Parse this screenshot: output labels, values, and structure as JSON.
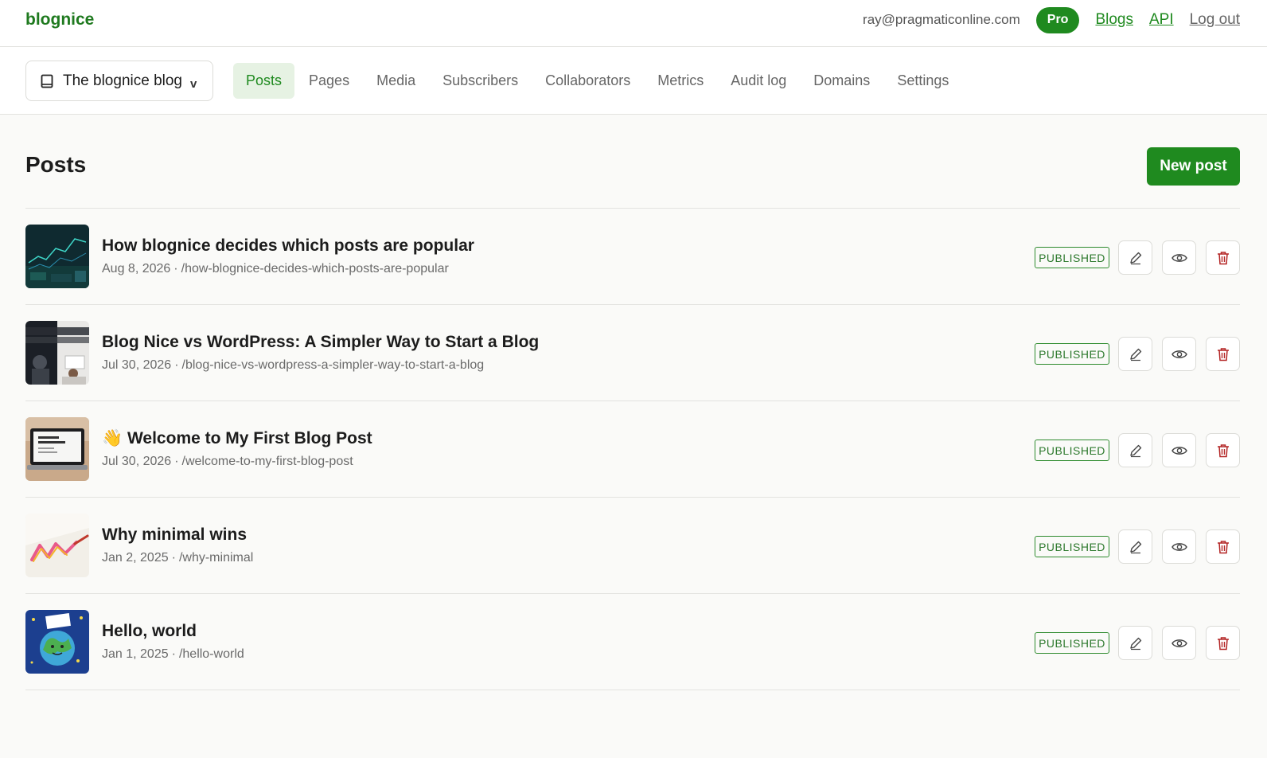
{
  "header": {
    "brand": "blognice",
    "email": "ray@pragmaticonline.com",
    "plan_badge": "Pro",
    "links": {
      "blogs": "Blogs",
      "api": "API",
      "logout": "Log out"
    }
  },
  "blog_selector": {
    "name": "The blognice blog",
    "caret": "v",
    "icon": "book-icon"
  },
  "tabs": [
    {
      "label": "Posts",
      "active": true
    },
    {
      "label": "Pages"
    },
    {
      "label": "Media"
    },
    {
      "label": "Subscribers"
    },
    {
      "label": "Collaborators"
    },
    {
      "label": "Metrics"
    },
    {
      "label": "Audit log"
    },
    {
      "label": "Domains"
    },
    {
      "label": "Settings"
    }
  ],
  "main": {
    "title": "Posts",
    "new_post_label": "New post"
  },
  "posts": [
    {
      "title": "How blognice decides which posts are popular",
      "date": "Aug 8, 2026",
      "slug": "/how-blognice-decides-which-posts-are-popular",
      "status": "PUBLISHED"
    },
    {
      "title": "Blog Nice vs WordPress: A Simpler Way to Start a Blog",
      "date": "Jul 30, 2026",
      "slug": "/blog-nice-vs-wordpress-a-simpler-way-to-start-a-blog",
      "status": "PUBLISHED"
    },
    {
      "title": "👋 Welcome to My First Blog Post",
      "date": "Jul 30, 2026",
      "slug": "/welcome-to-my-first-blog-post",
      "status": "PUBLISHED"
    },
    {
      "title": "Why minimal wins",
      "date": "Jan 2, 2025",
      "slug": "/why-minimal",
      "status": "PUBLISHED"
    },
    {
      "title": "Hello, world",
      "date": "Jan 1, 2025",
      "slug": "/hello-world",
      "status": "PUBLISHED"
    }
  ],
  "post_actions": [
    "pencil-icon",
    "eye-icon",
    "trash-icon"
  ],
  "colors": {
    "brand_green": "#1f8a1f",
    "active_tab_bg": "#e6f2e3",
    "delete_red": "#b32424",
    "background": "#fafaf8"
  }
}
